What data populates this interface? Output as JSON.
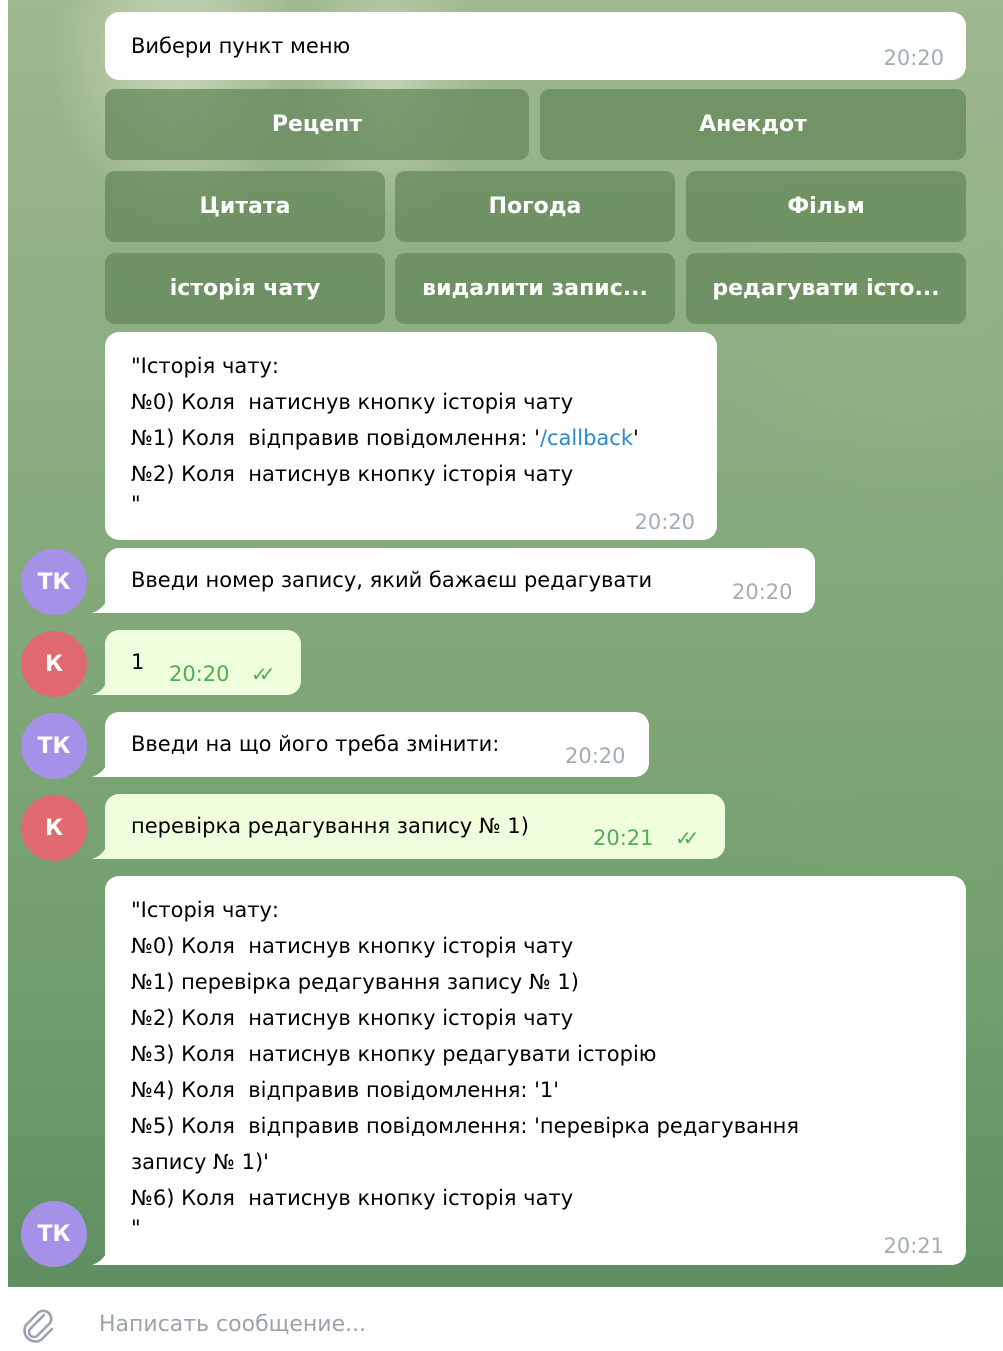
{
  "colors": {
    "bot_avatar": "#a592e8",
    "user_avatar": "#e16a6f",
    "incoming_bubble": "#ffffff",
    "outgoing_bubble": "#effedd",
    "outgoing_time": "#4fae4e",
    "link": "#2b8acf"
  },
  "menu_message": {
    "text": "Вибери пункт меню",
    "time": "20:20"
  },
  "keyboard": {
    "row1": [
      "Рецепт",
      "Анекдот"
    ],
    "row2": [
      "Цитата",
      "Погода",
      "Фільм"
    ],
    "row3": [
      "історія чату",
      "видалити запис...",
      "редагувати істо..."
    ]
  },
  "history1": {
    "lines": [
      "\"Історія чату:",
      "№0) Коля  натиснув кнопку історія чату",
      "№1) Коля  відправив повідомлення: '",
      "№2) Коля  натиснув кнопку історія чату",
      "\""
    ],
    "link": "/callback",
    "link_suffix": "'",
    "time": "20:20"
  },
  "msg_enter_number": {
    "avatar": "ТК",
    "text": "Введи номер запису, який бажаєш редагувати",
    "time": "20:20"
  },
  "msg_user_1": {
    "avatar": "К",
    "text": "1",
    "time": "20:20",
    "status_icon": "double-check-icon"
  },
  "msg_enter_change": {
    "avatar": "ТК",
    "text": "Введи на що його треба змінити:",
    "time": "20:20"
  },
  "msg_user_2": {
    "avatar": "К",
    "text": "перевірка редагування запису № 1)",
    "time": "20:21",
    "status_icon": "double-check-icon"
  },
  "history2": {
    "avatar": "ТК",
    "lines": [
      "\"Історія чату:",
      "№0) Коля  натиснув кнопку історія чату",
      "№1) перевірка редагування запису № 1)",
      "№2) Коля  натиснув кнопку історія чату",
      "№3) Коля  натиснув кнопку редагувати історію",
      "№4) Коля  відправив повідомлення: '1'",
      "№5) Коля  відправив повідомлення: 'перевірка редагування",
      "запису № 1)'",
      "№6) Коля  натиснув кнопку історія чату",
      "\""
    ],
    "time": "20:21"
  },
  "composer": {
    "placeholder": "Написать сообщение...",
    "icon": "paperclip-icon"
  }
}
